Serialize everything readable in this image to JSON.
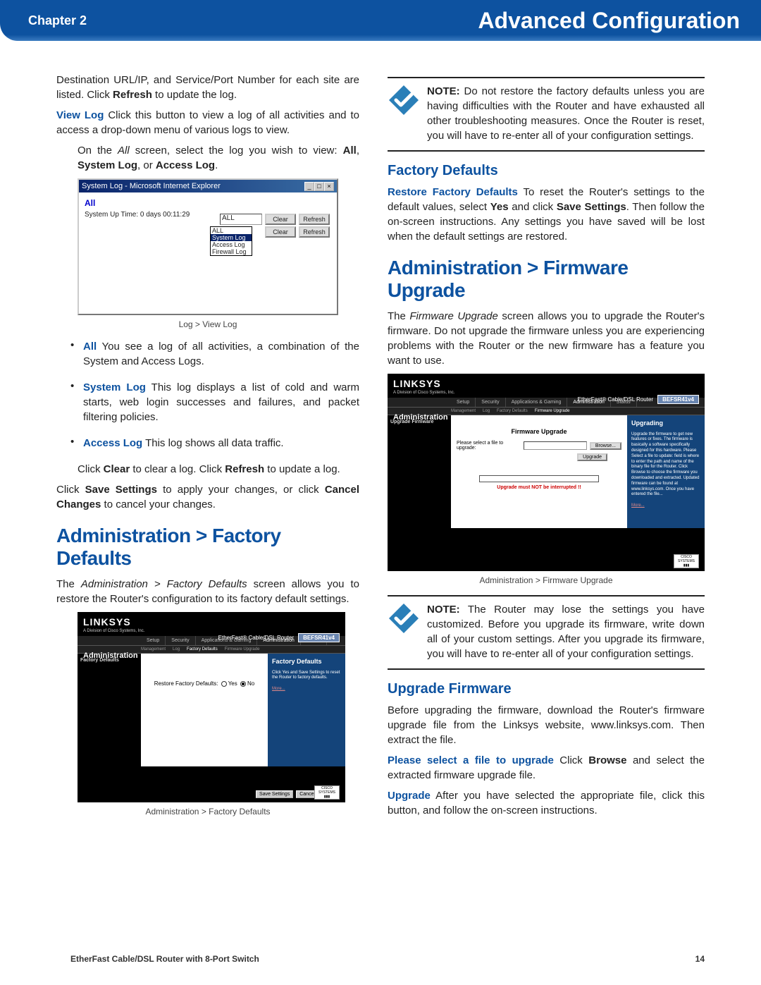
{
  "header": {
    "chapter": "Chapter 2",
    "title": "Advanced Configuration"
  },
  "left": {
    "p1a": "Destination URL/IP, and Service/Port Number for each site are listed. Click ",
    "p1b": "Refresh",
    "p1c": " to update the log.",
    "viewlog_label": "View Log",
    "viewlog_text": "  Click this button to view a log of all activities and to access a drop-down menu of various logs to view.",
    "onall_a": "On the ",
    "onall_i": "All",
    "onall_b": " screen, select the log you wish to view: ",
    "onall_c": "All",
    "onall_d": ", ",
    "onall_e": "System Log",
    "onall_f": ", or ",
    "onall_g": "Access Log",
    "onall_h": ".",
    "dlg": {
      "title": "System Log - Microsoft Internet Explorer",
      "all": "All",
      "uptime": "System Up Time: 0 days 00:11:29",
      "sel": "ALL",
      "clear": "Clear",
      "refresh": "Refresh",
      "opts": {
        "o1": "ALL",
        "o2": "System Log",
        "o3": "Access Log",
        "o4": "Firewall Log"
      }
    },
    "caption1": "Log > View Log",
    "b1_label": "All",
    "b1_text": "  You see a log of all activities, a combination of the System and Access Logs.",
    "b2_label": "System Log",
    "b2_text": "  This log displays a list of cold and warm starts, web login successes and failures, and packet filtering policies.",
    "b3_label": "Access Log",
    "b3_text": "  This log shows all data traffic.",
    "clear_a": "Click ",
    "clear_b": "Clear",
    "clear_c": " to clear a log. Click ",
    "clear_d": "Refresh",
    "clear_e": " to update a log.",
    "save_a": "Click ",
    "save_b": "Save Settings",
    "save_c": " to apply your changes, or click ",
    "save_d": "Cancel Changes",
    "save_e": " to cancel your changes.",
    "h2_fd": "Administration > Factory Defaults",
    "fd_para_a": "The ",
    "fd_para_i": "Administration > Factory Defaults",
    "fd_para_b": " screen allows you to restore the Router's configuration to its factory default settings.",
    "ss_fd": {
      "logo": "LINKSYS",
      "sub": "A Division of Cisco Systems, Inc.",
      "model_a": "EtherFast® Cable/DSL Router",
      "model_b": "BEFSR41v4",
      "admin": "Administration",
      "tabs": {
        "t1": "Setup",
        "t2": "Security",
        "t3": "Applications\n& Gaming",
        "t4": "Administration",
        "t5": "Status"
      },
      "sub1": "Management",
      "sub2": "Log",
      "sub3": "Factory Defaults",
      "sub4": "Firmware Upgrade",
      "left": "Factory Defaults",
      "center_lbl": "Restore Factory Defaults:",
      "yes": "Yes",
      "no": "No",
      "panel_title": "Factory Defaults",
      "panel_text": "Click Yes and Save Settings to reset the Router to factory defaults.",
      "more": "More...",
      "save": "Save Settings",
      "cancel": "Cancel Changes"
    },
    "caption2": "Administration > Factory Defaults"
  },
  "right": {
    "note1_a": "NOTE:",
    "note1_b": " Do not restore the factory defaults unless you are having difficulties with the Router and have exhausted all other troubleshooting measures. Once the Router is reset, you will have to re-enter all of your configuration settings.",
    "h3_fd": "Factory Defaults",
    "rfd_label": "Restore Factory Defaults",
    "rfd_a": "  To reset the Router's settings to the default values, select ",
    "rfd_b": "Yes",
    "rfd_c": " and click ",
    "rfd_d": "Save Settings",
    "rfd_e": ". Then follow the on-screen instructions. Any settings you have saved will be lost when the default settings are restored.",
    "h2_fw": "Administration > Firmware Upgrade",
    "fw_para_a": "The ",
    "fw_para_i": "Firmware Upgrade",
    "fw_para_b": " screen allows you to upgrade the Router's firmware. Do not upgrade the firmware unless you are experiencing problems with the Router or the new firmware has a feature you want to use.",
    "ss_fw": {
      "logo": "LINKSYS",
      "sub": "A Division of Cisco Systems, Inc.",
      "model_a": "EtherFast® Cable/DSL Router",
      "model_b": "BEFSR41v4",
      "admin": "Administration",
      "tabs": {
        "t1": "Setup",
        "t2": "Security",
        "t3": "Applications\n& Gaming",
        "t4": "Administration",
        "t5": "Status"
      },
      "sub1": "Management",
      "sub2": "Log",
      "sub3": "Factory Defaults",
      "sub4": "Firmware Upgrade",
      "left": "Upgrade Firmware",
      "fu_title": "Firmware Upgrade",
      "sel_lbl": "Please select a file to upgrade:",
      "browse": "Browse...",
      "upgrade": "Upgrade",
      "warn": "Upgrade must NOT be interrupted !!",
      "panel_title": "Upgrading",
      "panel_text": "Upgrade the firmware to get new features or fixes. The firmware is basically a software specifically designed for this hardware.\n\nPlease Select a file to update: field is where to enter the path and name of the binary file for the Router. Click Browse to choose the firmware you downloaded and extracted. Updated firmware can be found at www.linksys.com. Once you have entered the file...",
      "more": "More..."
    },
    "caption3": "Administration > Firmware Upgrade",
    "note2_a": "NOTE:",
    "note2_b": " The Router may lose the settings you have customized. Before you upgrade its firmware, write down all of your custom settings. After you upgrade its firmware, you will have to re-enter all of your configuration settings.",
    "h3_up": "Upgrade Firmware",
    "up_p1": "Before upgrading the firmware, download the Router's firmware upgrade file from the Linksys website, www.linksys.com. Then extract the file.",
    "pls_label": "Please select a file to upgrade",
    "pls_a": "  Click ",
    "pls_b": "Browse",
    "pls_c": " and select the extracted firmware upgrade file.",
    "upg_label": "Upgrade",
    "upg_a": "  After you have selected the appropriate file, click this button, and follow the on-screen instructions."
  },
  "footer": {
    "left": "EtherFast Cable/DSL Router with 8-Port Switch",
    "right": "14"
  }
}
